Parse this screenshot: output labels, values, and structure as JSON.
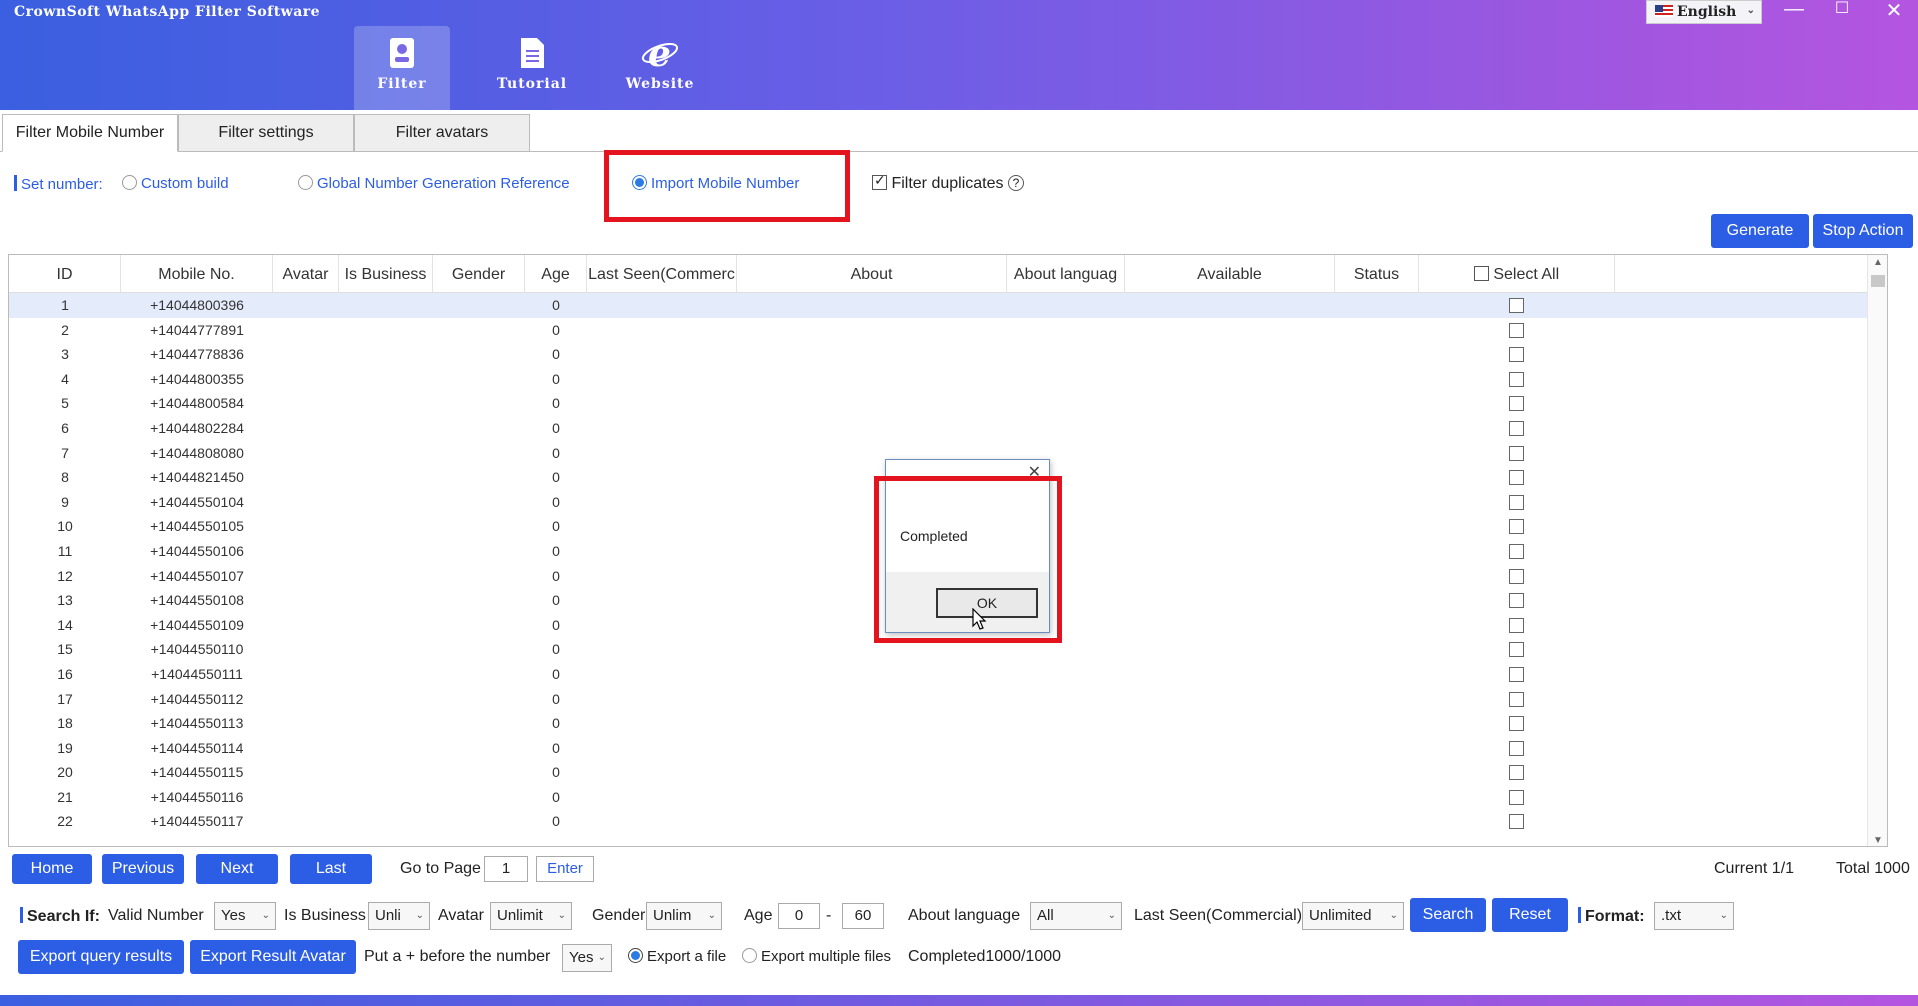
{
  "app": {
    "title": "CrownSoft WhatsApp Filter Software"
  },
  "nav": [
    {
      "label": "Filter",
      "icon": "filter-icon",
      "active": true
    },
    {
      "label": "Tutorial",
      "icon": "document-icon",
      "active": false
    },
    {
      "label": "Website",
      "icon": "browser-e-icon",
      "active": false
    }
  ],
  "language": {
    "selected": "English",
    "icon": "us-flag-icon"
  },
  "window_controls": {
    "minimize": "—",
    "maximize": "☐",
    "close": "✕"
  },
  "tabs": [
    {
      "label": "Filter Mobile Number",
      "active": true
    },
    {
      "label": "Filter settings",
      "active": false
    },
    {
      "label": "Filter avatars",
      "active": false
    }
  ],
  "set_number": {
    "label": "Set number:",
    "options": [
      {
        "label": "Custom build",
        "selected": false
      },
      {
        "label": "Global Number Generation Reference",
        "selected": false
      },
      {
        "label": "Import Mobile Number",
        "selected": true
      }
    ],
    "filter_duplicates": {
      "label": "Filter duplicates",
      "checked": true,
      "help_icon": "question-circle-icon"
    }
  },
  "actions": {
    "generate": "Generate",
    "stop": "Stop Action"
  },
  "table": {
    "columns": [
      "ID",
      "Mobile No.",
      "Avatar",
      "Is Business",
      "Gender",
      "Age",
      "Last Seen(Commerc",
      "About",
      "About languag",
      "Available",
      "Status",
      "Select All"
    ],
    "rows": [
      {
        "id": "1",
        "mobile": "+14044800396",
        "age": "0"
      },
      {
        "id": "2",
        "mobile": "+14044777891",
        "age": "0"
      },
      {
        "id": "3",
        "mobile": "+14044778836",
        "age": "0"
      },
      {
        "id": "4",
        "mobile": "+14044800355",
        "age": "0"
      },
      {
        "id": "5",
        "mobile": "+14044800584",
        "age": "0"
      },
      {
        "id": "6",
        "mobile": "+14044802284",
        "age": "0"
      },
      {
        "id": "7",
        "mobile": "+14044808080",
        "age": "0"
      },
      {
        "id": "8",
        "mobile": "+14044821450",
        "age": "0"
      },
      {
        "id": "9",
        "mobile": "+14044550104",
        "age": "0"
      },
      {
        "id": "10",
        "mobile": "+14044550105",
        "age": "0"
      },
      {
        "id": "11",
        "mobile": "+14044550106",
        "age": "0"
      },
      {
        "id": "12",
        "mobile": "+14044550107",
        "age": "0"
      },
      {
        "id": "13",
        "mobile": "+14044550108",
        "age": "0"
      },
      {
        "id": "14",
        "mobile": "+14044550109",
        "age": "0"
      },
      {
        "id": "15",
        "mobile": "+14044550110",
        "age": "0"
      },
      {
        "id": "16",
        "mobile": "+14044550111",
        "age": "0"
      },
      {
        "id": "17",
        "mobile": "+14044550112",
        "age": "0"
      },
      {
        "id": "18",
        "mobile": "+14044550113",
        "age": "0"
      },
      {
        "id": "19",
        "mobile": "+14044550114",
        "age": "0"
      },
      {
        "id": "20",
        "mobile": "+14044550115",
        "age": "0"
      },
      {
        "id": "21",
        "mobile": "+14044550116",
        "age": "0"
      },
      {
        "id": "22",
        "mobile": "+14044550117",
        "age": "0"
      }
    ]
  },
  "dialog": {
    "message": "Completed",
    "ok": "OK",
    "close": "✕"
  },
  "pager": {
    "home": "Home",
    "previous": "Previous",
    "next": "Next",
    "last": "Last",
    "goto_label": "Go to Page",
    "goto_value": "1",
    "enter": "Enter",
    "current": "Current 1/1",
    "total": "Total 1000"
  },
  "search": {
    "label": "Search If:",
    "valid_number_label": "Valid Number",
    "valid_number": "Yes",
    "is_business_label": "Is Business",
    "is_business": "Unli",
    "avatar_label": "Avatar",
    "avatar": "Unlimit",
    "gender_label": "Gender",
    "gender": "Unlim",
    "age_label": "Age",
    "age_min": "0",
    "age_sep": "-",
    "age_max": "60",
    "about_language_label": "About language",
    "about_language": "All",
    "last_seen_label": "Last Seen(Commercial)",
    "last_seen": "Unlimited",
    "search_btn": "Search",
    "reset_btn": "Reset",
    "format_label": "Format:",
    "format": ".txt"
  },
  "export": {
    "query_btn": "Export query results",
    "avatar_btn": "Export Result Avatar",
    "plus_label": "Put a + before the number",
    "plus_value": "Yes",
    "single_file": "Export a file",
    "multiple_files": "Export multiple files",
    "progress": "Completed1000/1000"
  },
  "colors": {
    "accent": "#2c5de5",
    "highlight": "#e3141d"
  }
}
